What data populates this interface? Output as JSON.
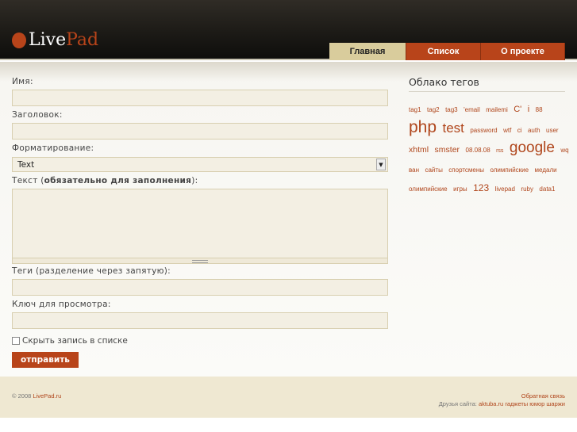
{
  "header": {
    "logo_live": "Live",
    "logo_pad": "Pad",
    "nav": [
      "Главная",
      "Список",
      "О проекте"
    ]
  },
  "form": {
    "name_label": "Имя:",
    "title_label": "Заголовок:",
    "format_label": "Форматирование:",
    "format_value": "Text",
    "text_label_pre": "Текст (",
    "text_label_bold": "обязательно для заполнения",
    "text_label_post": "):",
    "tags_label": "Теги (разделение через запятую):",
    "key_label": "Ключ для просмотра:",
    "hide_label": "Скрыть запись в списке",
    "submit": "отправить"
  },
  "sidebar": {
    "title": "Облако тегов",
    "tags": [
      {
        "t": "tag1",
        "s": 8
      },
      {
        "t": "tag2",
        "s": 8
      },
      {
        "t": "tag3",
        "s": 8
      },
      {
        "t": "'email",
        "s": 8
      },
      {
        "t": "mailemi",
        "s": 8
      },
      {
        "t": "C'",
        "s": 11
      },
      {
        "t": "i",
        "s": 11
      },
      {
        "t": "88",
        "s": 8
      },
      {
        "t": "php",
        "s": 21
      },
      {
        "t": "test",
        "s": 17
      },
      {
        "t": "password",
        "s": 8
      },
      {
        "t": "wtf",
        "s": 8
      },
      {
        "t": "ci",
        "s": 8
      },
      {
        "t": "auth",
        "s": 8
      },
      {
        "t": "user",
        "s": 8
      },
      {
        "t": "xhtml",
        "s": 10.5
      },
      {
        "t": "smster",
        "s": 10.5
      },
      {
        "t": "08.08.08",
        "s": 8
      },
      {
        "t": "rss",
        "s": 7
      },
      {
        "t": "google",
        "s": 19
      },
      {
        "t": "wq",
        "s": 8
      },
      {
        "t": "ван",
        "s": 8
      },
      {
        "t": "сайты",
        "s": 8
      },
      {
        "t": "спортсмены",
        "s": 8
      },
      {
        "t": "олимпийские",
        "s": 8
      },
      {
        "t": "медали",
        "s": 8
      },
      {
        "t": "олимпийские",
        "s": 8
      },
      {
        "t": "игры",
        "s": 8
      },
      {
        "t": "123",
        "s": 12
      },
      {
        "t": "livepad",
        "s": 8
      },
      {
        "t": "ruby",
        "s": 8
      },
      {
        "t": "data1",
        "s": 8
      }
    ]
  },
  "footer": {
    "copyright": "© 2008",
    "site": "LivePad.ru",
    "feedback": "Обратная связь",
    "friends_label": "Друзья сайта:",
    "friends": [
      "aktuba.ru",
      "гаджеты",
      "юмор шаржи"
    ]
  },
  "colors": {
    "accent": "#b8441a",
    "nav_active": "#d9cc9c",
    "field_bg": "#f3efe3",
    "footer_bg": "#efe8d2"
  }
}
